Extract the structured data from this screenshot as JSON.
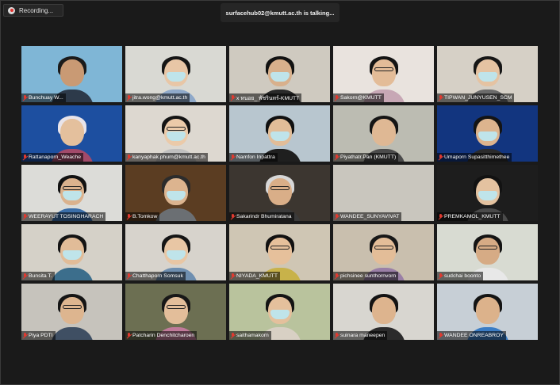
{
  "recording": {
    "label": "Recording..."
  },
  "talking": {
    "text": "surfacehub02@kmutt.ac.th is talking..."
  },
  "participants": [
    {
      "name": "Bunchuay W...",
      "bg": "#7fb6d6",
      "skin": "#c99a74",
      "hair": "#1b1b1b",
      "shirt": "#2d3a4a",
      "mask": false,
      "glasses": false
    },
    {
      "name": "jitra.wong@kmutt.ac.th",
      "bg": "#d9d9d3",
      "skin": "#e8c6a6",
      "hair": "#151515",
      "shirt": "#8fa9c9",
      "mask": true,
      "glasses": false
    },
    {
      "name": "x หนอย_ พัชรินทร์-KMUTT",
      "bg": "#cfcac0",
      "skin": "#d8b08c",
      "hair": "#121212",
      "shirt": "#2a2a2a",
      "mask": true,
      "glasses": false
    },
    {
      "name": "Sakorn@KMUTT",
      "bg": "#e9e3de",
      "skin": "#e3bc98",
      "hair": "#141414",
      "shirt": "#c7a7b5",
      "mask": false,
      "glasses": true
    },
    {
      "name": "TIPWAN_JUNYUSEN_SCM",
      "bg": "#d6d0c6",
      "skin": "#e5c3a2",
      "hair": "#161616",
      "shirt": "#6b6b6b",
      "mask": true,
      "glasses": false
    },
    {
      "name": "Rattanaporn_Weache",
      "bg": "#1d4fa0",
      "skin": "#e4c09d",
      "hair": "#e8e4ea",
      "shirt": "#a24a6a",
      "mask": false,
      "glasses": false,
      "banner": "2023"
    },
    {
      "name": "kanyaphak.phum@kmutt.ac.th",
      "bg": "#ddd8d0",
      "skin": "#ebcaa9",
      "hair": "#131313",
      "shirt": "#bfbfbf",
      "mask": true,
      "glasses": true
    },
    {
      "name": "Namfon Inpattra",
      "bg": "#b8c6cf",
      "skin": "#e2bd98",
      "hair": "#101010",
      "shirt": "#1f1f1f",
      "mask": true,
      "glasses": false
    },
    {
      "name": "Piyathatr.Pan (KMUTT)",
      "bg": "#bcbcb2",
      "skin": "#dfb894",
      "hair": "#151515",
      "shirt": "#4b4b4b",
      "mask": false,
      "glasses": false
    },
    {
      "name": "Umaporn Supasitthimethee",
      "bg": "#12357f",
      "skin": "#ddb48e",
      "hair": "#141414",
      "shirt": "#2b2b2b",
      "mask": true,
      "glasses": false,
      "banner": "SIT"
    },
    {
      "name": "WEERAYUT TOSINGHARACH",
      "bg": "#dcdcd8",
      "skin": "#dbb28d",
      "hair": "#121212",
      "shirt": "#3b6ea8",
      "mask": true,
      "glasses": true
    },
    {
      "name": "B.Tomkow",
      "bg": "#5b3d22",
      "skin": "#dcb48f",
      "hair": "#2c2c2c",
      "shirt": "#6b6f73",
      "mask": true,
      "glasses": false
    },
    {
      "name": "Sakarindr Bhumiratana",
      "bg": "#3c3630",
      "skin": "#d9ae88",
      "hair": "#d7d7d7",
      "shirt": "#3a3a3a",
      "mask": false,
      "glasses": true
    },
    {
      "name": "WANDEE_SUNYAVIVAT",
      "bg": "#c9c6be",
      "skin": "#e0c0a0",
      "hair": "#1a1a1a",
      "shirt": "#8a8a8a",
      "mask": false,
      "glasses": false,
      "empty": true
    },
    {
      "name": "PREMKAMOL_KMUTT",
      "bg": "#1d1d1d",
      "skin": "#e4c2a0",
      "hair": "#121212",
      "shirt": "#4a4a4a",
      "mask": true,
      "glasses": false
    },
    {
      "name": "Bunsita T.",
      "bg": "#d5d1c8",
      "skin": "#e1bc98",
      "hair": "#141414",
      "shirt": "#3c6e8c",
      "mask": true,
      "glasses": false
    },
    {
      "name": "Chatthaporn Somsuk",
      "bg": "#d7d3cc",
      "skin": "#e8c6a4",
      "hair": "#151515",
      "shirt": "#6f8fb0",
      "mask": true,
      "glasses": false
    },
    {
      "name": "NIYADA_KMUTT",
      "bg": "#cfc6b4",
      "skin": "#e6c09b",
      "hair": "#111111",
      "shirt": "#c8b24a",
      "mask": false,
      "glasses": true
    },
    {
      "name": "pichsinee sunthornvorn",
      "bg": "#c9bfae",
      "skin": "#e3bd98",
      "hair": "#181818",
      "shirt": "#9a7fa6",
      "mask": false,
      "glasses": true
    },
    {
      "name": "sudchai boonto",
      "bg": "#d8dbd2",
      "skin": "#d6ab85",
      "hair": "#141414",
      "shirt": "#e8e8e8",
      "mask": false,
      "glasses": true
    },
    {
      "name": "Piya PDTI",
      "bg": "#c6c3bc",
      "skin": "#ddb58f",
      "hair": "#151515",
      "shirt": "#3f4f63",
      "mask": false,
      "glasses": true
    },
    {
      "name": "Patcharin Denchitcharoen",
      "bg": "#6c6f52",
      "skin": "#e3be9a",
      "hair": "#181818",
      "shirt": "#c07a9a",
      "mask": false,
      "glasses": true
    },
    {
      "name": "saithamakorn",
      "bg": "#b9c39d",
      "skin": "#e4c09c",
      "hair": "#141414",
      "shirt": "#d8d0c4",
      "mask": true,
      "glasses": false
    },
    {
      "name": "suinara maneepen",
      "bg": "#d8d6d0",
      "skin": "#ddb48e",
      "hair": "#131313",
      "shirt": "#2b2b2b",
      "mask": false,
      "glasses": false
    },
    {
      "name": "WANDEE ONREABROY",
      "bg": "#c7cfd6",
      "skin": "#dcb28b",
      "hair": "#141414",
      "shirt": "#3a7cc4",
      "mask": false,
      "glasses": false
    }
  ],
  "speaking_index": 0
}
